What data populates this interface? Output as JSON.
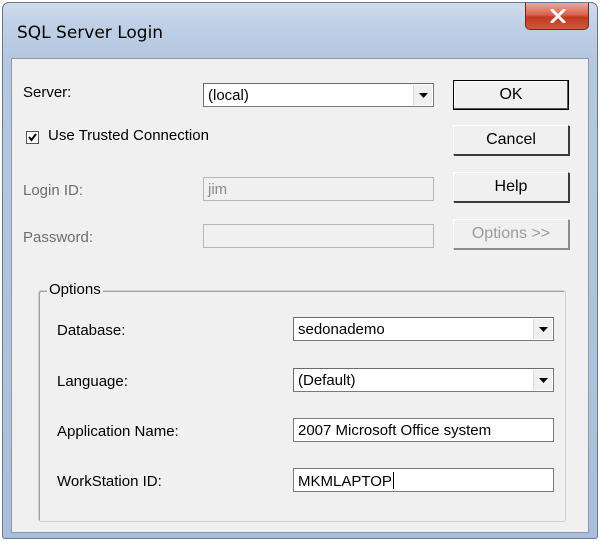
{
  "window": {
    "title": "SQL Server Login",
    "close_icon": "close-icon"
  },
  "server": {
    "label": "Server:",
    "value": "(local)"
  },
  "trusted": {
    "label": "Use Trusted Connection",
    "checked": true
  },
  "login": {
    "label": "Login ID:",
    "value": "jim"
  },
  "password": {
    "label": "Password:",
    "value": ""
  },
  "buttons": {
    "ok": "OK",
    "cancel": "Cancel",
    "help": "Help",
    "options": "Options >>"
  },
  "options_group": {
    "legend": "Options",
    "database": {
      "label": "Database:",
      "value": "sedonademo"
    },
    "language": {
      "label": "Language:",
      "value": "(Default)"
    },
    "app_name": {
      "label": "Application Name:",
      "value": "2007 Microsoft Office system"
    },
    "workstation": {
      "label": "WorkStation ID:",
      "value": "MKMLAPTOP"
    }
  }
}
